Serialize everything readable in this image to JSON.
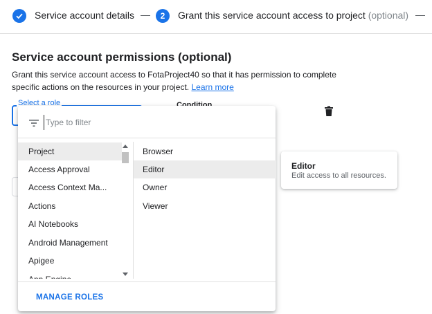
{
  "stepper": {
    "step1": {
      "label": "Service account details"
    },
    "step2": {
      "number": "2",
      "label": "Grant this service account access to project",
      "optional": "(optional)"
    }
  },
  "section": {
    "title": "Service account permissions (optional)",
    "description": "Grant this service account access to FotaProject40 so that it has permission to complete specific actions on the resources in your project.",
    "learn_more": "Learn more"
  },
  "role_select": {
    "label": "Select a role"
  },
  "condition": {
    "label": "Condition"
  },
  "role_menu": {
    "filter_placeholder": "Type to filter",
    "services": [
      "Project",
      "Access Approval",
      "Access Context Ma...",
      "Actions",
      "AI Notebooks",
      "Android Management",
      "Apigee",
      "App Engine"
    ],
    "selected_service": "Project",
    "roles": [
      "Browser",
      "Editor",
      "Owner",
      "Viewer"
    ],
    "highlighted_role": "Editor",
    "manage_roles": "MANAGE ROLES"
  },
  "role_card": {
    "title": "Editor",
    "description": "Edit access to all resources."
  },
  "colors": {
    "accent": "#1a73e8",
    "text": "#202124",
    "secondary": "#5f6368"
  }
}
